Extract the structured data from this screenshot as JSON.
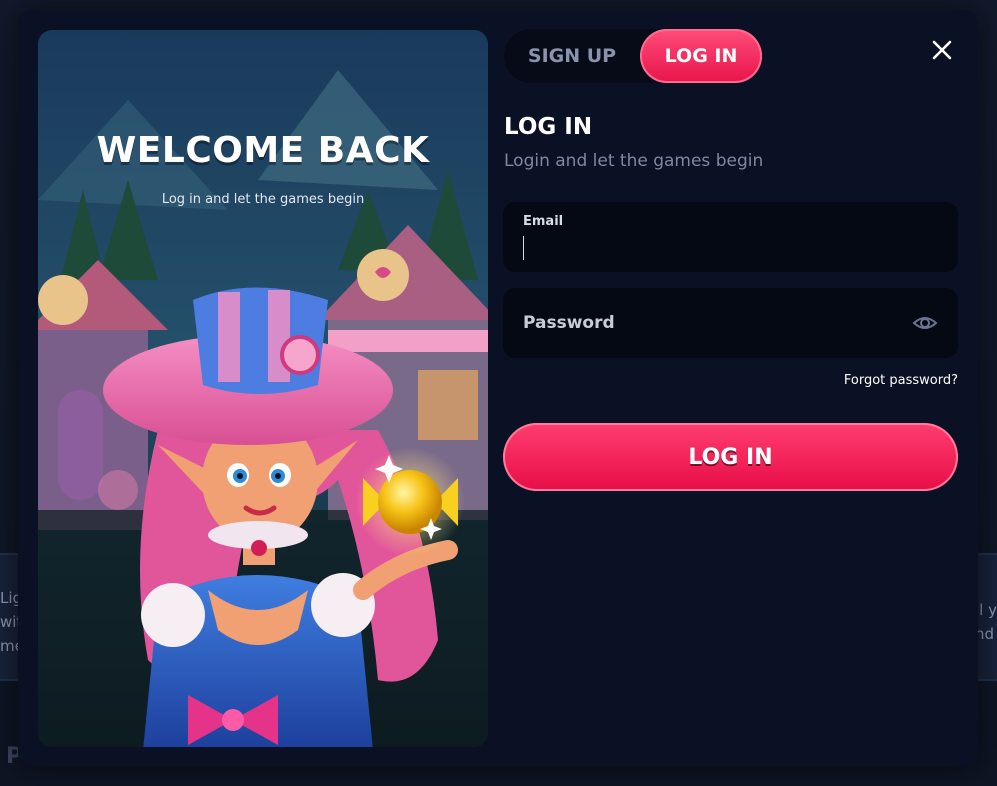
{
  "background": {
    "left_fragment": [
      "Lig",
      "wit",
      "me"
    ],
    "right_fragment": [
      "ll y",
      "nd"
    ],
    "partial_heading": "Po"
  },
  "art": {
    "title": "WELCOME BACK",
    "subtitle": "Log in and let the games begin"
  },
  "tabs": [
    {
      "label": "SIGN UP",
      "active": false
    },
    {
      "label": "LOG IN",
      "active": true
    }
  ],
  "form": {
    "title": "LOG IN",
    "subtitle": "Login and let the games begin",
    "email": {
      "label": "Email",
      "value": ""
    },
    "password": {
      "placeholder": "Password",
      "value": ""
    },
    "forgot_label": "Forgot password?",
    "submit_label": "LOG IN"
  },
  "icons": {
    "close": "close-icon",
    "eye": "eye-icon"
  },
  "colors": {
    "accent": "#ff2e63",
    "modal_bg": "#0b1124",
    "field_bg": "#050914",
    "muted_text": "#7e87a3"
  }
}
